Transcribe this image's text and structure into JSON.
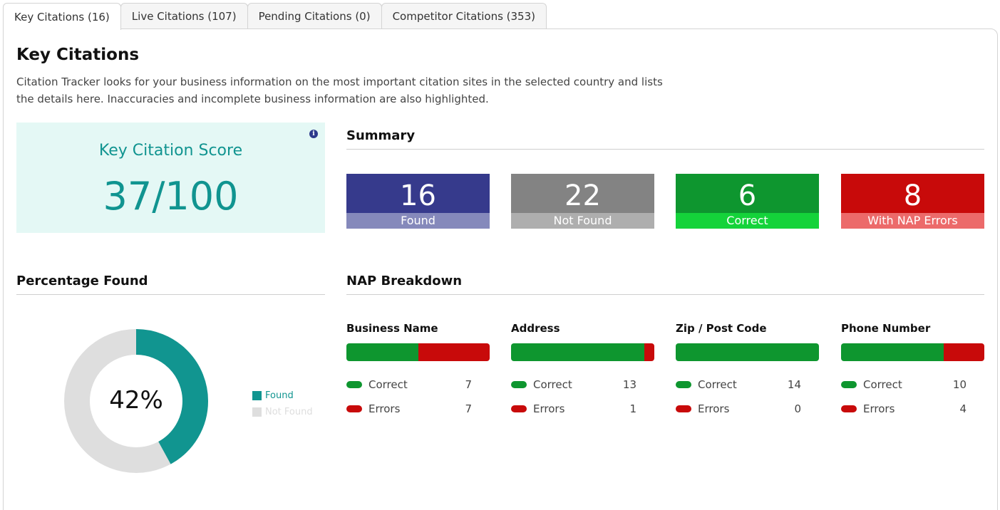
{
  "tabs": [
    {
      "label": "Key Citations (16)"
    },
    {
      "label": "Live Citations (107)"
    },
    {
      "label": "Pending Citations (0)"
    },
    {
      "label": "Competitor Citations (353)"
    }
  ],
  "page": {
    "title": "Key Citations",
    "description": "Citation Tracker looks for your business information on the most important citation sites in the selected country and lists the details here. Inaccuracies and incomplete business information are also highlighted."
  },
  "score": {
    "label": "Key Citation Score",
    "value": "37/100",
    "info_icon": "info-icon"
  },
  "summary": {
    "title": "Summary",
    "boxes": [
      {
        "value": "16",
        "label": "Found",
        "color": "#363a8c",
        "label_bg": "#8589bb"
      },
      {
        "value": "22",
        "label": "Not Found",
        "color": "#838383",
        "label_bg": "#aeaeae"
      },
      {
        "value": "6",
        "label": "Correct",
        "color": "#0e962f",
        "label_bg": "#14d33a"
      },
      {
        "value": "8",
        "label": "With NAP Errors",
        "color": "#c80a0a",
        "label_bg": "#ec6a6a"
      }
    ]
  },
  "percentage": {
    "title": "Percentage Found",
    "center_label": "42%",
    "found_fraction": 0.42,
    "legend": [
      {
        "label": "Found",
        "color": "#119590"
      },
      {
        "label": "Not Found",
        "color": "#dedede"
      }
    ]
  },
  "nap": {
    "title": "NAP Breakdown",
    "correct_label": "Correct",
    "errors_label": "Errors",
    "items": [
      {
        "title": "Business Name",
        "correct": "7",
        "errors": "7"
      },
      {
        "title": "Address",
        "correct": "13",
        "errors": "1"
      },
      {
        "title": "Zip / Post Code",
        "correct": "14",
        "errors": "0"
      },
      {
        "title": "Phone Number",
        "correct": "10",
        "errors": "4"
      }
    ]
  }
}
